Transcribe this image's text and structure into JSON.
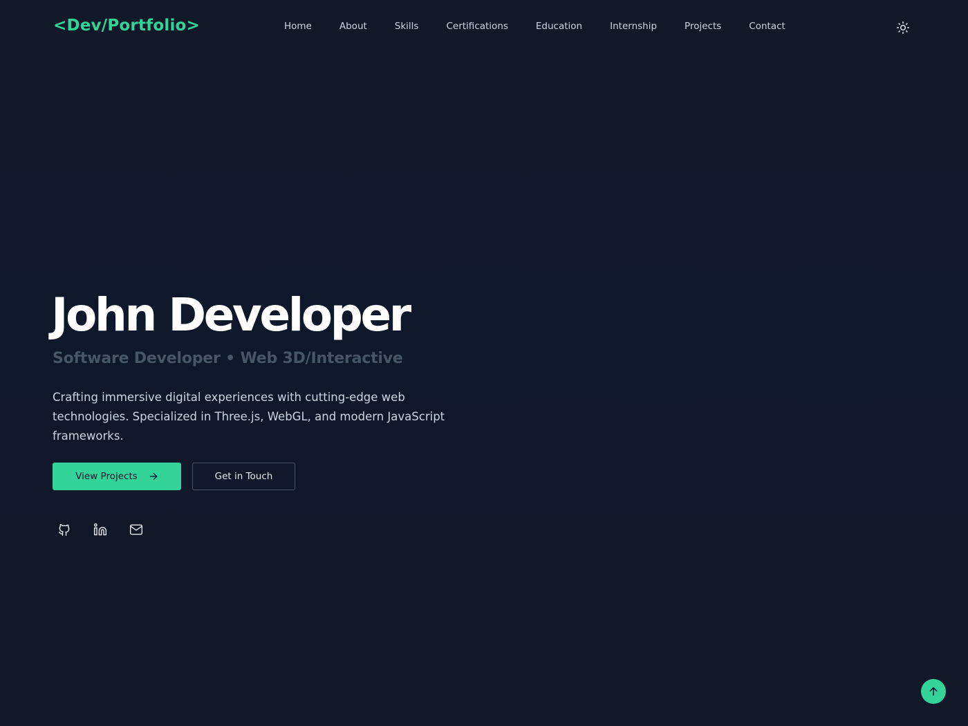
{
  "nav": {
    "logo": "<Dev/Portfolio>",
    "links": [
      "Home",
      "About",
      "Skills",
      "Certifications",
      "Education",
      "Internship",
      "Projects",
      "Contact"
    ],
    "theme_icon": "sun-icon"
  },
  "hero": {
    "name": "John Developer",
    "subtitle": "Software Developer • Web 3D/Interactive",
    "description": "Crafting immersive digital experiences with cutting-edge web technologies. Specialized in Three.js, WebGL, and modern JavaScript frameworks.",
    "primary_button": "View Projects",
    "primary_button_icon": "arrow-right-icon",
    "secondary_button": "Get in Touch",
    "socials": [
      "github-icon",
      "linkedin-icon",
      "mail-icon"
    ]
  },
  "scroll_top_icon": "arrow-up-icon",
  "colors": {
    "background": "#111827",
    "accent": "#34d399",
    "text": "#e5e7eb",
    "muted": "#475569"
  }
}
